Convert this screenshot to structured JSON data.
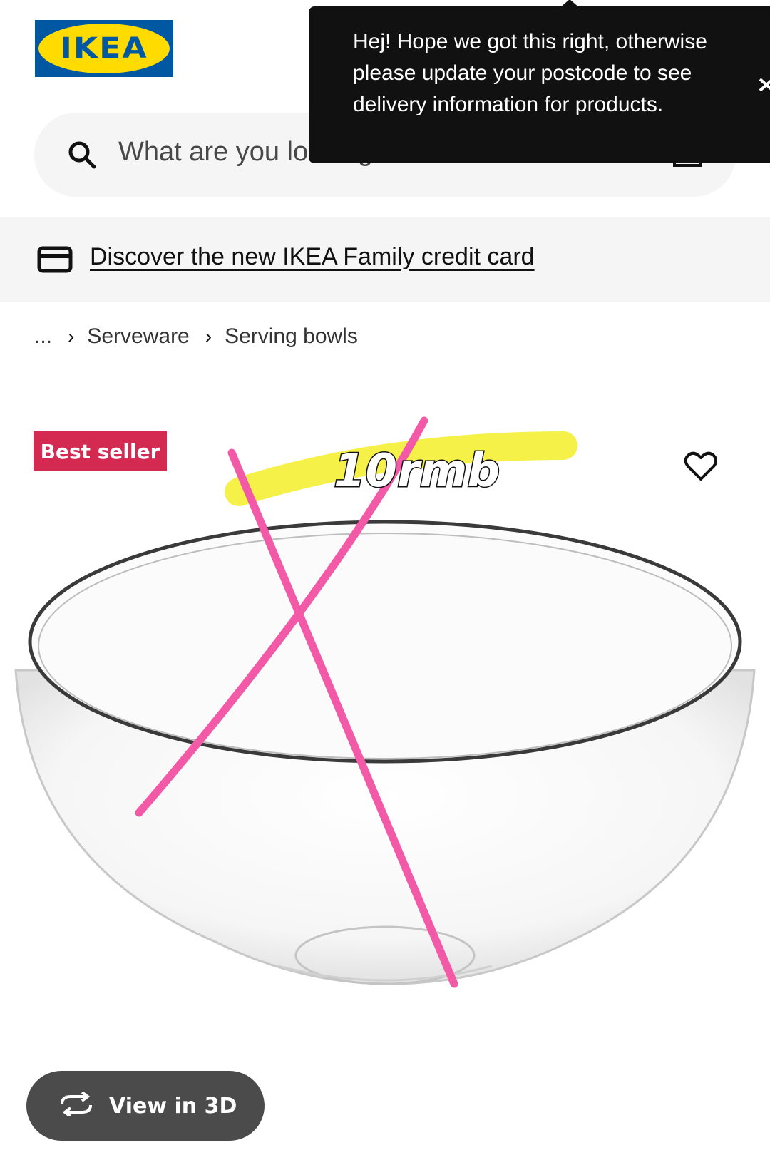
{
  "header": {
    "logo_text": "IKEA",
    "search": {
      "placeholder": "What are you looking for?"
    }
  },
  "tooltip": {
    "message": "Hej! Hope we got this right, otherwise please update your postcode to see delivery information for products.",
    "close_icon": "close-icon"
  },
  "promo": {
    "link_text": "Discover the new IKEA Family credit card",
    "icon": "credit-card-icon"
  },
  "breadcrumb": {
    "ellipsis": "...",
    "items": [
      "Serveware",
      "Serving bowls"
    ]
  },
  "product": {
    "badge": "Best seller",
    "annotation": "10rmb",
    "favourite_icon": "heart-icon",
    "view_3d_label": "View in 3D"
  },
  "colors": {
    "brand_blue": "#0058a3",
    "brand_yellow": "#ffdb00",
    "badge": "#d42a52",
    "annotation_pink": "#f25aa7",
    "highlighter_yellow": "#f4f034"
  }
}
